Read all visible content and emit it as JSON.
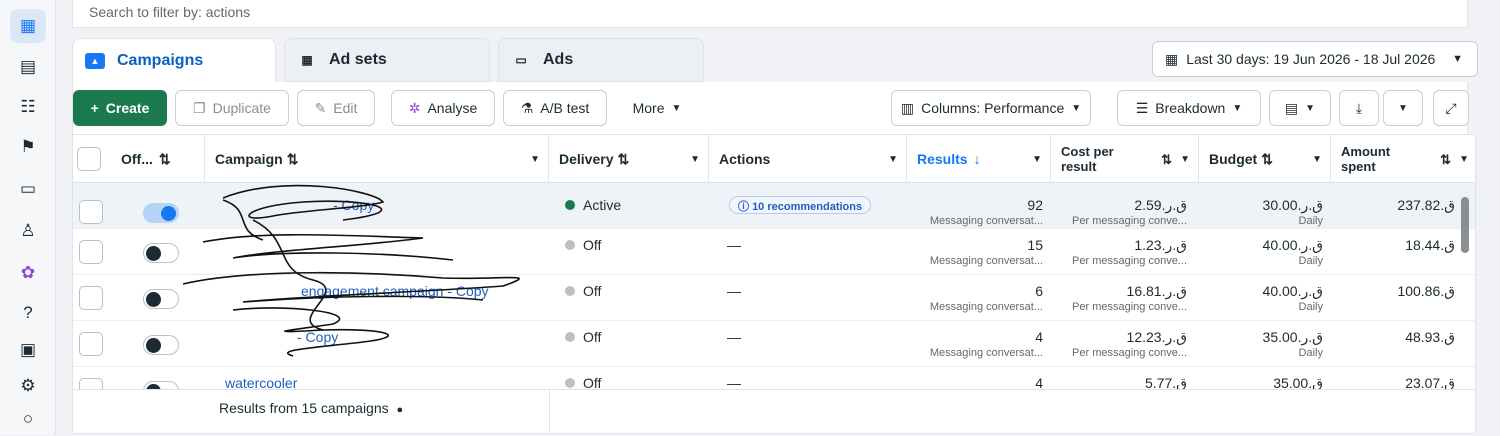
{
  "search": {
    "placeholder": "Search to filter by: actions"
  },
  "tabs": [
    {
      "label": "Campaigns",
      "icon": "folder-icon"
    },
    {
      "label": "Ad sets",
      "icon": "grid-icon"
    },
    {
      "label": "Ads",
      "icon": "ad-icon"
    }
  ],
  "date_range": "Last 30 days: 19 Jun 2026 - 18 Jul 2026",
  "toolbar": {
    "create": "Create",
    "duplicate": "Duplicate",
    "edit": "Edit",
    "analyse": "Analyse",
    "ab_test": "A/B test",
    "more": "More",
    "columns": "Columns: Performance",
    "breakdown": "Breakdown"
  },
  "columns": {
    "off": "Off...",
    "campaign": "Campaign",
    "delivery": "Delivery",
    "actions": "Actions",
    "results": "Results",
    "cost_per_result": "Cost per result",
    "budget": "Budget",
    "amount_spent": "Amount spent"
  },
  "rows": [
    {
      "name": "- Copy",
      "delivery": "Active",
      "actions": "10 recommendations",
      "results": "92",
      "results_sub": "Messaging conversat...",
      "cpr": "2.59.ق.ر",
      "cpr_sub": "Per messaging conve...",
      "budget": "30.00.ق.ر",
      "budget_sub": "Daily",
      "spent": "237.82.ق",
      "toggle": "on"
    },
    {
      "name": "",
      "delivery": "Off",
      "actions": "—",
      "results": "15",
      "results_sub": "Messaging conversat...",
      "cpr": "1.23.ق.ر",
      "cpr_sub": "Per messaging conve...",
      "budget": "40.00.ق.ر",
      "budget_sub": "Daily",
      "spent": "18.44.ق",
      "toggle": "off"
    },
    {
      "name": "engagement campaign - Copy",
      "delivery": "Off",
      "actions": "—",
      "results": "6",
      "results_sub": "Messaging conversat...",
      "cpr": "16.81.ق.ر",
      "cpr_sub": "Per messaging conve...",
      "budget": "40.00.ق.ر",
      "budget_sub": "Daily",
      "spent": "100.86.ق",
      "toggle": "off"
    },
    {
      "name": "- Copy",
      "delivery": "Off",
      "actions": "—",
      "results": "4",
      "results_sub": "Messaging conversat...",
      "cpr": "12.23.ق.ر",
      "cpr_sub": "Per messaging conve...",
      "budget": "35.00.ق.ر",
      "budget_sub": "Daily",
      "spent": "48.93.ق",
      "toggle": "off"
    },
    {
      "name": "watercooler",
      "delivery": "Off",
      "actions": "—",
      "results": "4",
      "results_sub": "",
      "cpr": "5.77.ق",
      "cpr_sub": "",
      "budget": "35.00.ق",
      "budget_sub": "",
      "spent": "23.07.ق",
      "toggle": "off"
    }
  ],
  "footer": {
    "summary": "Results from 15 campaigns"
  }
}
